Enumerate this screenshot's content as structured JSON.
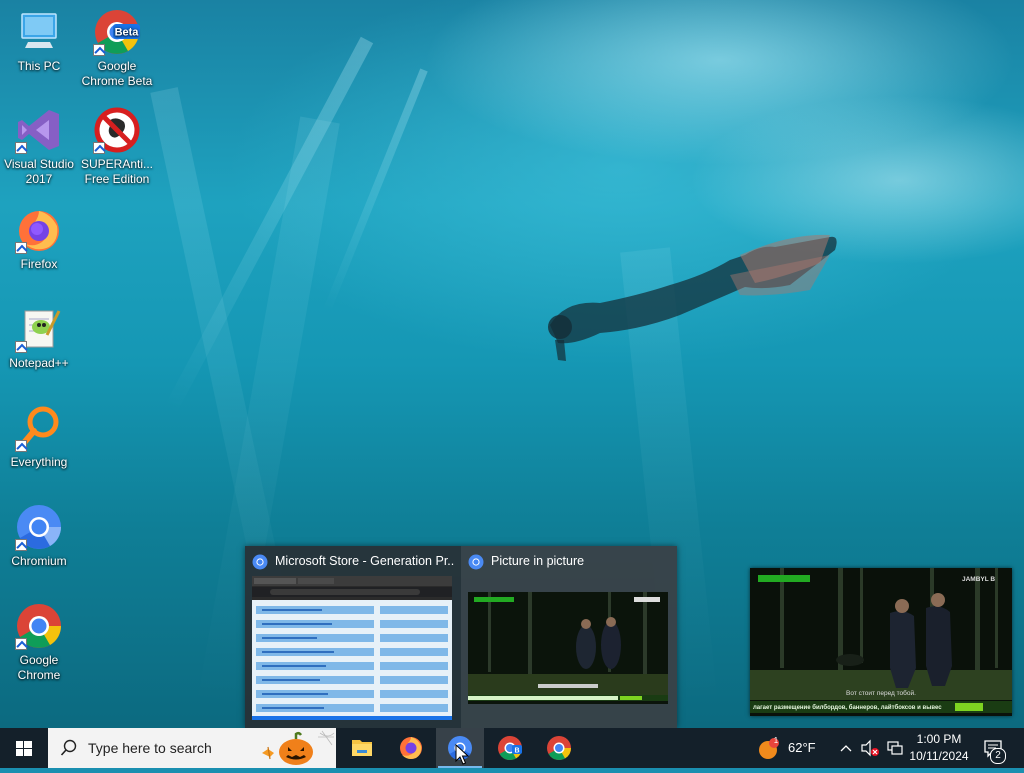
{
  "desktop": {
    "icons": [
      {
        "label": "This PC",
        "icon": "this-pc-icon"
      },
      {
        "label": "Google Chrome Beta",
        "icon": "chrome-beta-icon",
        "badge": "Beta"
      },
      {
        "label": "Visual Studio 2017",
        "icon": "visual-studio-icon"
      },
      {
        "label": "SUPERAnti... Free Edition",
        "icon": "superantispyware-icon"
      },
      {
        "label": "Firefox",
        "icon": "firefox-icon"
      },
      {
        "label": "Notepad++",
        "icon": "notepad-plus-plus-icon"
      },
      {
        "label": "Everything",
        "icon": "everything-search-icon"
      },
      {
        "label": "Chromium",
        "icon": "chromium-icon"
      },
      {
        "label": "Google Chrome",
        "icon": "chrome-icon"
      }
    ]
  },
  "thumbnails": [
    {
      "title": "Microsoft Store - Generation Pr...",
      "icon": "chrome-icon"
    },
    {
      "title": "Picture in picture",
      "icon": "chrome-icon"
    }
  ],
  "pip": {
    "channel_logo": "JAMBYL B",
    "caption": "Вот стоит перед тобой.",
    "ticker": "лагает размещение билбордов, баннеров, лайтбоксов и вывес"
  },
  "taskbar": {
    "search_placeholder": "Type here to search",
    "apps": [
      {
        "name": "File Explorer",
        "icon": "file-explorer-icon"
      },
      {
        "name": "Firefox",
        "icon": "firefox-icon"
      },
      {
        "name": "Chromium",
        "icon": "chromium-icon",
        "active": true
      },
      {
        "name": "Google Chrome Beta",
        "icon": "chrome-beta-icon"
      },
      {
        "name": "Google Chrome",
        "icon": "chrome-icon"
      }
    ],
    "weather": {
      "temperature": "62°F",
      "badge": "1"
    },
    "clock": {
      "time": "1:00 PM",
      "date": "10/11/2024"
    },
    "notifications_count": "2"
  },
  "colors": {
    "taskbar": "#14202a",
    "accent": "#76b9ed",
    "chrome_red": "#db4437",
    "chrome_yellow": "#f4c20d",
    "chrome_green": "#0f9d58",
    "chrome_blue": "#4285f4"
  }
}
